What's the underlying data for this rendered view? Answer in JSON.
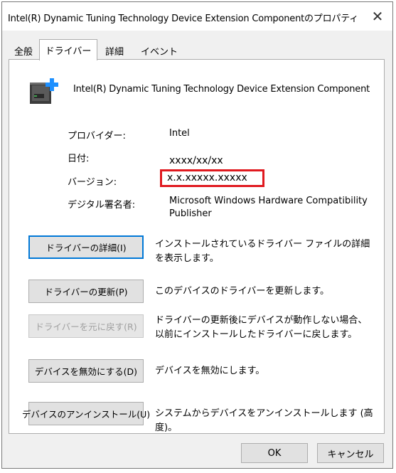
{
  "window": {
    "title": "Intel(R) Dynamic Tuning Technology Device Extension Componentのプロパティ",
    "close_glyph": "✕"
  },
  "tabs": [
    {
      "label": "全般",
      "active": false
    },
    {
      "label": "ドライバー",
      "active": true
    },
    {
      "label": "詳細",
      "active": false
    },
    {
      "label": "イベント",
      "active": false
    }
  ],
  "device": {
    "name": "Intel(R) Dynamic Tuning Technology Device Extension Component",
    "icon": "device-extension-icon"
  },
  "properties": {
    "provider_label": "プロバイダー:",
    "provider_value": "Intel",
    "date_label": "日付:",
    "date_value": "xxxx/xx/xx",
    "version_label": "バージョン:",
    "version_value": "x.x.xxxxx.xxxxx",
    "signer_label": "デジタル署名者:",
    "signer_value": "Microsoft Windows Hardware Compatibility Publisher"
  },
  "actions": [
    {
      "button": "ドライバーの詳細(I)",
      "description": "インストールされているドライバー ファイルの詳細を表示します。",
      "enabled": true
    },
    {
      "button": "ドライバーの更新(P)",
      "description": "このデバイスのドライバーを更新します。",
      "enabled": true
    },
    {
      "button": "ドライバーを元に戻す(R)",
      "description": "ドライバーの更新後にデバイスが動作しない場合、以前にインストールしたドライバーに戻します。",
      "enabled": false
    },
    {
      "button": "デバイスを無効にする(D)",
      "description": "デバイスを無効にします。",
      "enabled": true
    },
    {
      "button": "デバイスのアンインストール(U)",
      "description": "システムからデバイスをアンインストールします (高度)。",
      "enabled": true
    }
  ],
  "footer": {
    "ok_label": "OK",
    "cancel_label": "キャンセル"
  },
  "colors": {
    "highlight_border": "#e0191f",
    "focus_border": "#0078d7",
    "icon_blue": "#1e90ff"
  }
}
